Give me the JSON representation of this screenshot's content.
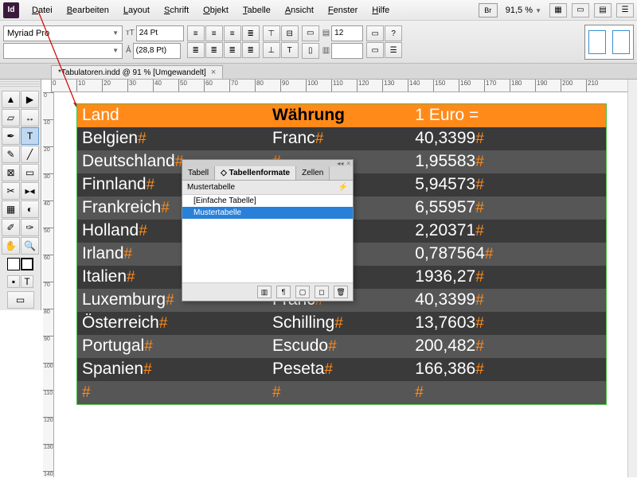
{
  "app": {
    "icon_label": "Id"
  },
  "menubar": {
    "items": [
      "Datei",
      "Bearbeiten",
      "Layout",
      "Schrift",
      "Objekt",
      "Tabelle",
      "Ansicht",
      "Fenster",
      "Hilfe"
    ],
    "br": "Br",
    "zoom": "91,5 %"
  },
  "control": {
    "font": "Myriad Pro",
    "size": "24 Pt",
    "leading": "(28,8 Pt)",
    "cols": "12"
  },
  "document": {
    "tab_title": "*Tabulatoren.indd @ 91 % [Umgewandelt]"
  },
  "ruler_h": [
    "0",
    "10",
    "20",
    "30",
    "40",
    "50",
    "60",
    "70",
    "80",
    "90",
    "100",
    "110",
    "120",
    "130",
    "140",
    "150",
    "160",
    "170",
    "180",
    "190",
    "200",
    "210"
  ],
  "ruler_v": [
    "0",
    "10",
    "20",
    "30",
    "40",
    "50",
    "60",
    "70",
    "80",
    "90",
    "100",
    "110",
    "120",
    "130",
    "140"
  ],
  "table": {
    "headers": [
      "Land",
      "Währung",
      "1 Euro ="
    ],
    "rows": [
      [
        "Belgien",
        "Franc",
        "40,3399"
      ],
      [
        "Deutschland",
        "",
        "1,95583"
      ],
      [
        "Finnland",
        "",
        "5,94573"
      ],
      [
        "Frankreich",
        "",
        "6,55957"
      ],
      [
        "Holland",
        "",
        "2,20371"
      ],
      [
        "Irland",
        "",
        "0,787564"
      ],
      [
        "Italien",
        "",
        "1936,27"
      ],
      [
        "Luxemburg",
        "Franc",
        "40,3399"
      ],
      [
        "Österreich",
        "Schilling",
        "13,7603"
      ],
      [
        "Portugal",
        "Escudo",
        "200,482"
      ],
      [
        "Spanien",
        "Peseta",
        "166,386"
      ],
      [
        "",
        "",
        ""
      ]
    ]
  },
  "panel": {
    "tabs": [
      "Tabell",
      "Tabellenformate",
      "Zellen"
    ],
    "current_style": "Mustertabelle",
    "items": [
      "[Einfache Tabelle]",
      "Mustertabelle"
    ],
    "selected_index": 1
  }
}
